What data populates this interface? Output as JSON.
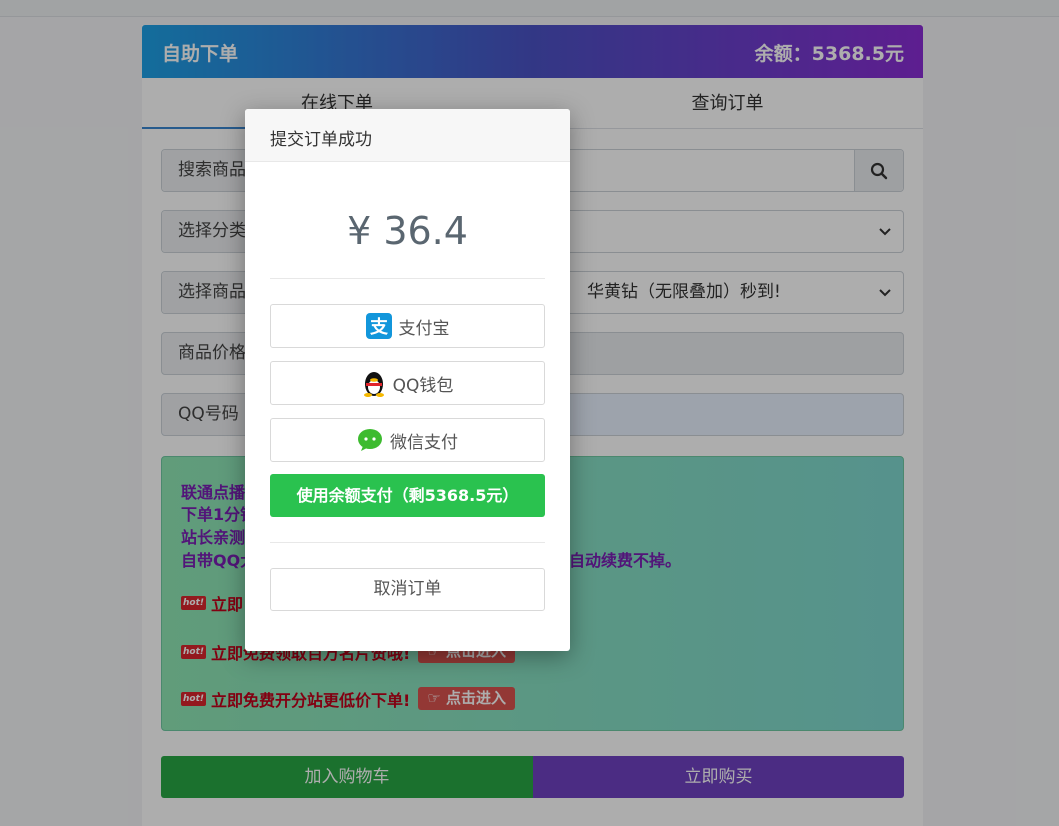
{
  "header": {
    "title": "自助下单",
    "balance": "余额：5368.5元"
  },
  "tabs": [
    {
      "label": "在线下单"
    },
    {
      "label": "查询订单"
    }
  ],
  "form": {
    "search_label": "搜索商品",
    "category_label": "选择分类",
    "product_label": "选择商品",
    "product_value": "华黄钻（无限叠加）秒到!",
    "price_label": "商品价格",
    "qq_label": "QQ号码"
  },
  "notice": {
    "lines": [
      "联通点播",
      "下单1分钟",
      "站长亲测",
      "自带QQ大"
    ],
    "line4_tail": "自动续费不掉。",
    "hot_badge": "hot!",
    "hot_rows": [
      {
        "text": "立即",
        "button": ""
      },
      {
        "text": "立即免费领取百万名片赞哦!",
        "button": "点击进入"
      },
      {
        "text": "立即免费开分站更低价下单!",
        "button": "点击进入"
      }
    ]
  },
  "buttons": {
    "cart": "加入购物车",
    "buy": "立即购买"
  },
  "modal": {
    "title": "提交订单成功",
    "amount": "¥ 36.4",
    "alipay": "支付宝",
    "qqwallet": "QQ钱包",
    "wechat": "微信支付",
    "balance_pay": "使用余额支付（剩5368.5元）",
    "cancel": "取消订单"
  },
  "colors": {
    "brand_gradient_start": "#1da1e6",
    "brand_gradient_end": "#8a2dd4",
    "pay_green": "#2ac24f",
    "cart_green": "#28a745",
    "buy_purple": "#6f42c1"
  }
}
